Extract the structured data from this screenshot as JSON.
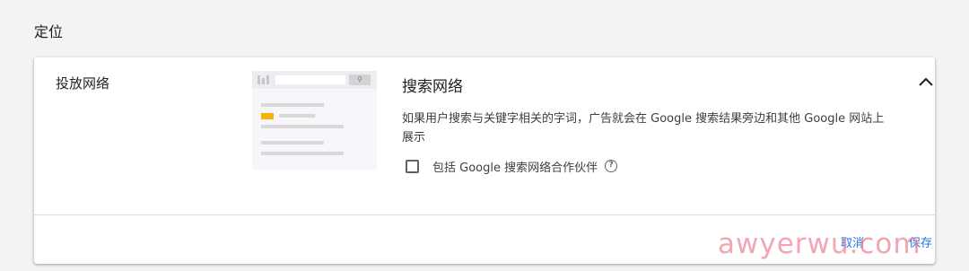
{
  "section": {
    "title": "定位"
  },
  "card": {
    "label": "投放网络",
    "content_title": "搜索网络",
    "description": "如果用户搜索与关键字相关的字词，广告就会在 Google 搜索结果旁边和其他 Google 网站上展示",
    "checkbox": {
      "label": "包括 Google 搜索网络合作伙伴",
      "checked": false
    },
    "help_icon": "?",
    "collapse_icon": "chevron-up-icon"
  },
  "footer": {
    "cancel_label": "取消",
    "save_label": "保存"
  },
  "watermark": {
    "text": "awyerwu.com"
  },
  "colors": {
    "accent": "#1a73e8",
    "ad_badge": "#f4b400"
  }
}
